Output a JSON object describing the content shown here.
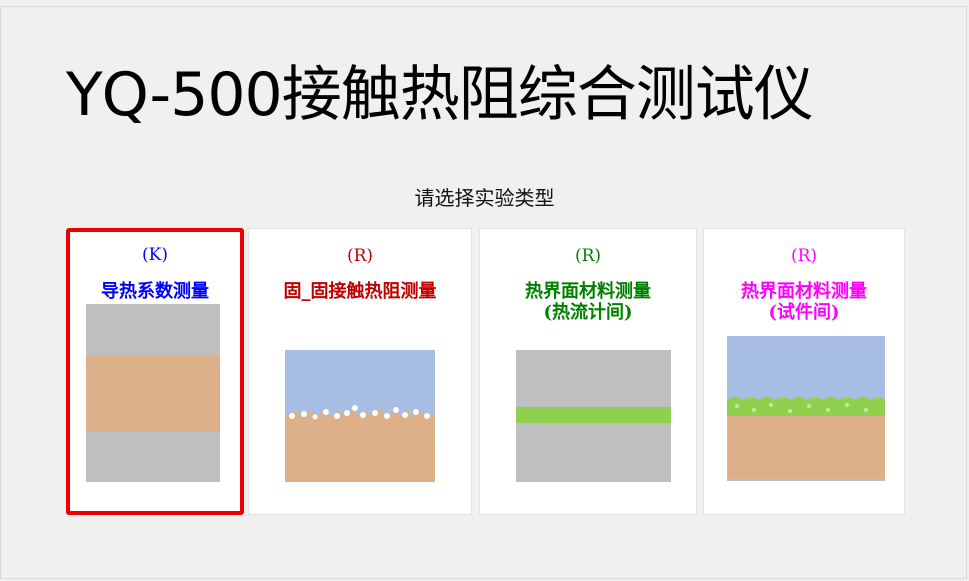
{
  "title": "YQ-500接触热阻综合测试仪",
  "prompt": "请选择实验类型",
  "colors": {
    "selected_border": "#ee0000",
    "gray_layer": "#bfbfbf",
    "tan_layer": "#deb08a",
    "blue_layer": "#a7bde4",
    "green_layer": "#8fd14f"
  },
  "cards": [
    {
      "tag": "(K)",
      "title": "导热系数测量",
      "color": "#0000ff",
      "selected": true
    },
    {
      "tag": "(R)",
      "title": "固_固接触热阻测量",
      "color": "#c00000",
      "selected": false
    },
    {
      "tag": "(R)",
      "title": "热界面材料测量",
      "subtitle": "(热流计间)",
      "color": "#008000",
      "selected": false
    },
    {
      "tag": "(R)",
      "title": "热界面材料测量",
      "subtitle": "(试件间)",
      "color": "#ff00ff",
      "selected": false
    }
  ]
}
